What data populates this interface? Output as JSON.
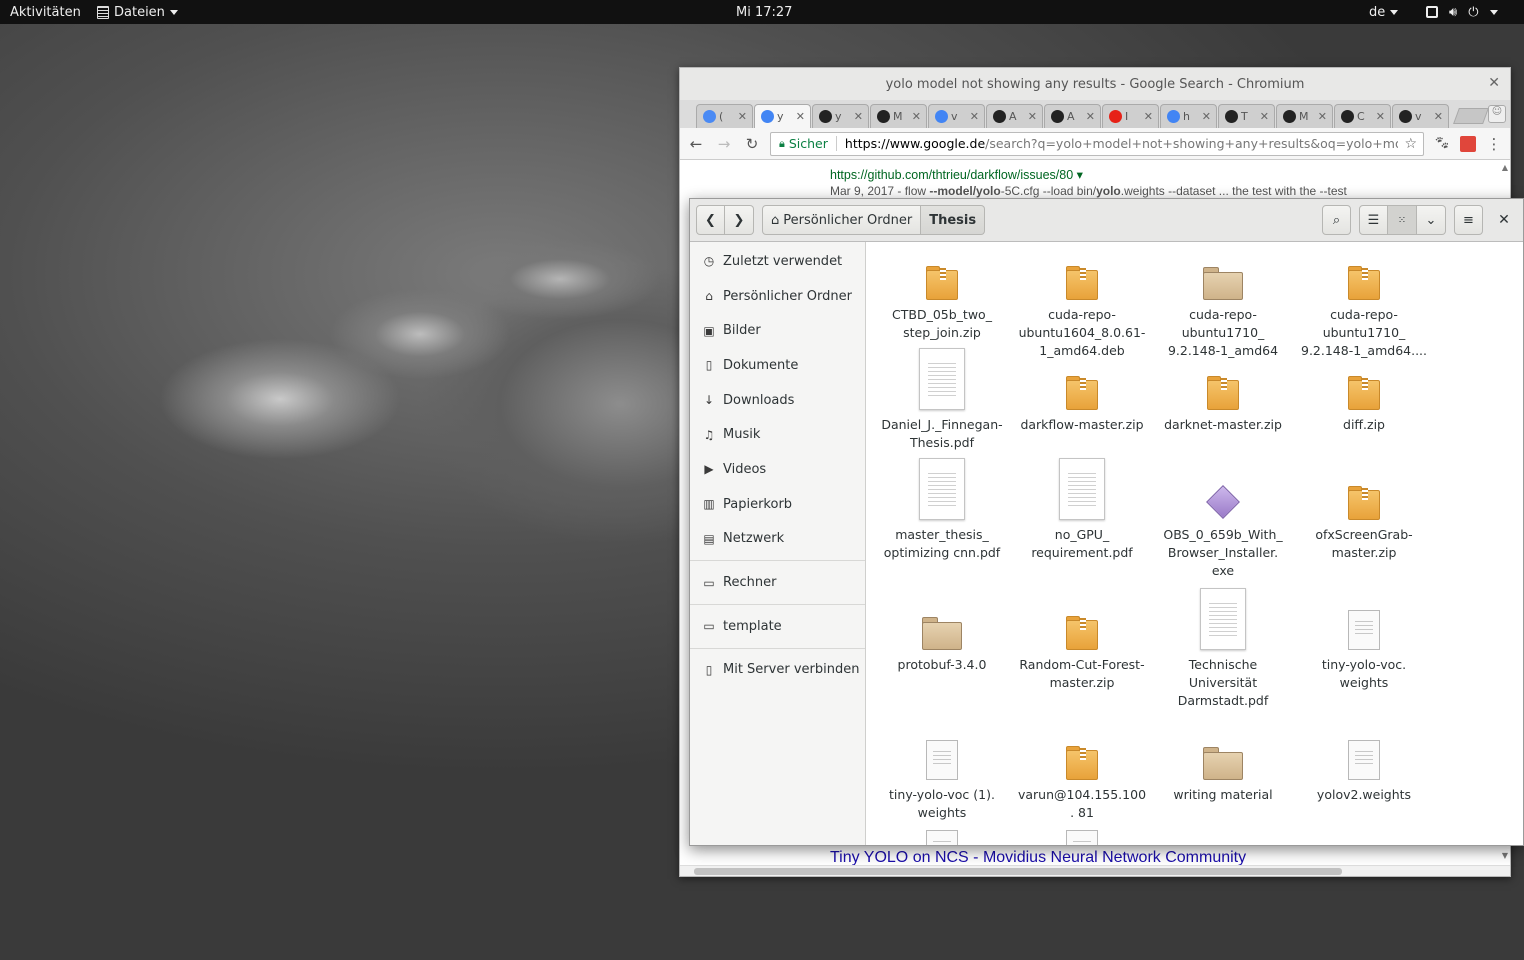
{
  "topbar": {
    "activities": "Aktivitäten",
    "app_menu": "Dateien",
    "clock": "Mi 17:27",
    "language": "de"
  },
  "chrome": {
    "window_title": "yolo model not showing any results - Google Search - Chromium",
    "tabs": [
      {
        "text": "(",
        "favicon": "chromium-icon",
        "color": "#4a8af4"
      },
      {
        "text": "y",
        "favicon": "google-icon",
        "color": "#4285f4"
      },
      {
        "text": "y",
        "favicon": "github-icon",
        "color": "#222222"
      },
      {
        "text": "M",
        "favicon": "github-icon",
        "color": "#222222"
      },
      {
        "text": "v",
        "favicon": "google-icon",
        "color": "#4285f4"
      },
      {
        "text": "A",
        "favicon": "github-icon",
        "color": "#222222"
      },
      {
        "text": "A",
        "favicon": "github-icon",
        "color": "#222222"
      },
      {
        "text": "I",
        "favicon": "youtube-icon",
        "color": "#e62117"
      },
      {
        "text": "h",
        "favicon": "google-icon",
        "color": "#4285f4"
      },
      {
        "text": "T",
        "favicon": "github-icon",
        "color": "#222222"
      },
      {
        "text": "M",
        "favicon": "github-icon",
        "color": "#222222"
      },
      {
        "text": "C",
        "favicon": "github-icon",
        "color": "#222222"
      },
      {
        "text": "v",
        "favicon": "github-icon",
        "color": "#222222"
      }
    ],
    "secure_label": "Sicher",
    "url_host": "https://www.google.de",
    "url_rest": "/search?q=yolo+model+not+showing+any+results&oq=yolo+model+n...",
    "page": {
      "result_url": "https://github.com/thtrieu/darkflow/issues/80 ▾",
      "snippet_date": "Mar 9, 2017 - flow ",
      "snippet_b1": "--model/yolo",
      "snippet_mid": "-5C.cfg --load bin/",
      "snippet_b2": "yolo",
      "snippet_end": ".weights --dataset ... the test with the --test",
      "bottom_link": "Tiny YOLO on NCS - Movidius Neural Network Community"
    }
  },
  "nautilus": {
    "path": [
      "Persönlicher Ordner",
      "Thesis"
    ],
    "sidebar": [
      {
        "label": "Zuletzt verwendet",
        "icon": "clock-icon"
      },
      {
        "label": "Persönlicher Ordner",
        "icon": "home-icon"
      },
      {
        "label": "Bilder",
        "icon": "camera-icon"
      },
      {
        "label": "Dokumente",
        "icon": "document-icon"
      },
      {
        "label": "Downloads",
        "icon": "download-icon"
      },
      {
        "label": "Musik",
        "icon": "music-icon"
      },
      {
        "label": "Videos",
        "icon": "video-icon"
      },
      {
        "label": "Papierkorb",
        "icon": "trash-icon"
      },
      {
        "label": "Netzwerk",
        "icon": "network-icon"
      },
      {
        "label": "Rechner",
        "icon": "drive-icon"
      },
      {
        "label": "template",
        "icon": "folder-icon"
      },
      {
        "label": "Mit Server verbinden",
        "icon": "server-icon"
      }
    ],
    "files": [
      {
        "name": "CTBD_05b_two_ step_join.zip",
        "type": "zip"
      },
      {
        "name": "cuda-repo- ubuntu1604_8.0.61- 1_amd64.deb",
        "type": "zip"
      },
      {
        "name": "cuda-repo- ubuntu1710_ 9.2.148-1_amd64",
        "type": "folder"
      },
      {
        "name": "cuda-repo- ubuntu1710_ 9.2.148-1_amd64....",
        "type": "zip"
      },
      {
        "name": "Daniel_J._Finnegan- Thesis.pdf",
        "type": "pdf"
      },
      {
        "name": "darkflow-master.zip",
        "type": "zip"
      },
      {
        "name": "darknet-master.zip",
        "type": "zip"
      },
      {
        "name": "diff.zip",
        "type": "zip"
      },
      {
        "name": "master_thesis_ optimizing cnn.pdf",
        "type": "pdf"
      },
      {
        "name": "no_GPU_ requirement.pdf",
        "type": "pdf"
      },
      {
        "name": "OBS_0_659b_With_ Browser_Installer. exe",
        "type": "exe"
      },
      {
        "name": "ofxScreenGrab- master.zip",
        "type": "zip"
      },
      {
        "name": "protobuf-3.4.0",
        "type": "folder"
      },
      {
        "name": "Random-Cut-Forest- master.zip",
        "type": "zip"
      },
      {
        "name": "Technische Universität Darmstadt.pdf",
        "type": "pdf"
      },
      {
        "name": "tiny-yolo-voc. weights",
        "type": "doc"
      },
      {
        "name": "tiny-yolo-voc (1). weights",
        "type": "doc"
      },
      {
        "name": "varun@104.155.100. 81",
        "type": "zip"
      },
      {
        "name": "writing material",
        "type": "folder"
      },
      {
        "name": "yolov2.weights",
        "type": "doc"
      },
      {
        "name": "",
        "type": "doc"
      },
      {
        "name": "",
        "type": "doc"
      }
    ]
  }
}
